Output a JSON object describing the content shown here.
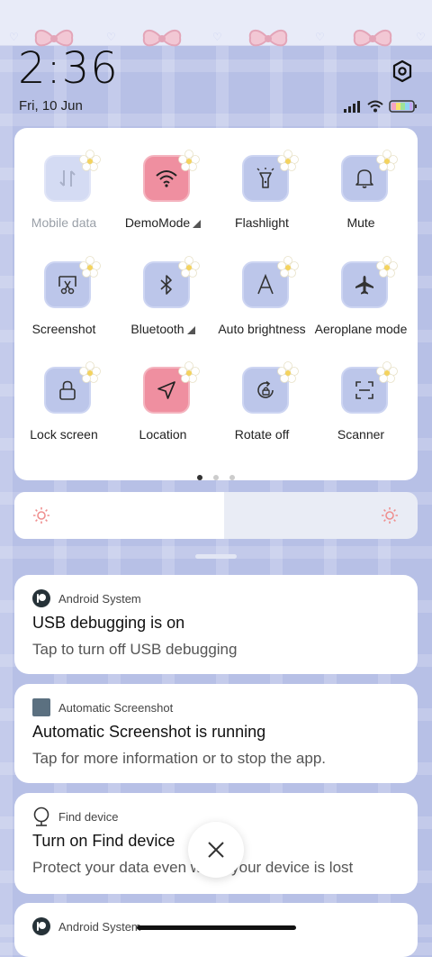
{
  "status": {
    "time": "2:36",
    "date": "Fri, 10 Jun"
  },
  "quick_settings": {
    "tiles": [
      {
        "label": "Mobile data",
        "icon": "mobile-data-icon",
        "state": "disabled"
      },
      {
        "label": "DemoMode",
        "icon": "wifi-icon",
        "state": "active",
        "expandable": true
      },
      {
        "label": "Flashlight",
        "icon": "flashlight-icon",
        "state": "off"
      },
      {
        "label": "Mute",
        "icon": "bell-icon",
        "state": "off"
      },
      {
        "label": "Screenshot",
        "icon": "screenshot-icon",
        "state": "off"
      },
      {
        "label": "Bluetooth",
        "icon": "bluetooth-icon",
        "state": "off",
        "expandable": true
      },
      {
        "label": "Auto brightness",
        "icon": "auto-brightness-icon",
        "state": "off"
      },
      {
        "label": "Aeroplane mode",
        "icon": "airplane-icon",
        "state": "off"
      },
      {
        "label": "Lock screen",
        "icon": "lock-icon",
        "state": "off"
      },
      {
        "label": "Location",
        "icon": "location-icon",
        "state": "active"
      },
      {
        "label": "Rotate off",
        "icon": "rotate-icon",
        "state": "off"
      },
      {
        "label": "Scanner",
        "icon": "scanner-icon",
        "state": "off"
      }
    ],
    "page_count": 3,
    "current_page": 1
  },
  "brightness": {
    "level": 0.52
  },
  "notifications": [
    {
      "app": "Android System",
      "icon": "android-system-icon",
      "title": "USB debugging is on",
      "body": "Tap to turn off USB debugging"
    },
    {
      "app": "Automatic Screenshot",
      "icon": "automatic-screenshot-app-icon",
      "title": "Automatic Screenshot is running",
      "body": "Tap for more information or to stop the app."
    },
    {
      "app": "Find device",
      "icon": "find-device-icon",
      "title": "Turn on Find device",
      "body": "Protect your data even when your device is lost"
    },
    {
      "app": "Android System",
      "icon": "android-system-icon",
      "title": "",
      "body": ""
    }
  ],
  "colors": {
    "active_tile": "#ef8fa0",
    "inactive_tile": "#bcc6ea",
    "background": "#b7c0e6"
  }
}
